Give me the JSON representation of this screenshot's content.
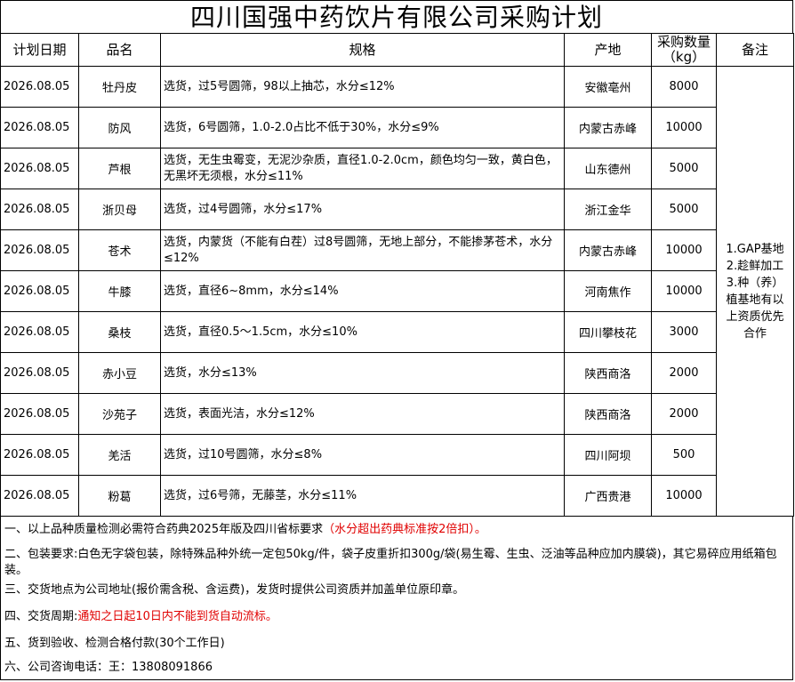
{
  "title": "四川国强中药饮片有限公司采购计划",
  "headers": {
    "date": "计划日期",
    "name": "品名",
    "spec": "规格",
    "origin": "产地",
    "qty_line1": "采购数量",
    "qty_line2": "（kg）",
    "remark": "备注"
  },
  "rows": [
    {
      "date": "2026.08.05",
      "name": "牡丹皮",
      "spec": "选货，过5号圆筛，98以上抽芯，水分≤12%",
      "origin": "安徽亳州",
      "qty": "8000"
    },
    {
      "date": "2026.08.05",
      "name": "防风",
      "spec": "选货，6号圆筛，1.0-2.0占比不低于30%，水分≤9%",
      "origin": "内蒙古赤峰",
      "qty": "10000"
    },
    {
      "date": "2026.08.05",
      "name": "芦根",
      "spec": "选货，无生虫霉变，无泥沙杂质，直径1.0-2.0cm，颜色均匀一致，黄白色，无黑坏无须根，水分≤11%",
      "origin": "山东德州",
      "qty": "5000"
    },
    {
      "date": "2026.08.05",
      "name": "浙贝母",
      "spec": "选货，过4号圆筛，水分≤17%",
      "origin": "浙江金华",
      "qty": "5000"
    },
    {
      "date": "2026.08.05",
      "name": "苍术",
      "spec": "选货，内蒙货（不能有白茬）过8号圆筛，无地上部分，不能掺茅苍术，水分≤12%",
      "origin": "内蒙古赤峰",
      "qty": "10000"
    },
    {
      "date": "2026.08.05",
      "name": "牛膝",
      "spec": "选货，直径6~8mm，水分≤14%",
      "origin": "河南焦作",
      "qty": "10000"
    },
    {
      "date": "2026.08.05",
      "name": "桑枝",
      "spec": "选货，直径0.5～1.5cm，水分≤10%",
      "origin": "四川攀枝花",
      "qty": "3000"
    },
    {
      "date": "2026.08.05",
      "name": "赤小豆",
      "spec": "选货，水分≤13%",
      "origin": "陕西商洛",
      "qty": "2000"
    },
    {
      "date": "2026.08.05",
      "name": "沙苑子",
      "spec": "选货，表面光洁，水分≤12%",
      "origin": "陕西商洛",
      "qty": "2000"
    },
    {
      "date": "2026.08.05",
      "name": "羌活",
      "spec": "选货，过10号圆筛，水分≤8%",
      "origin": "四川阿坝",
      "qty": "500"
    },
    {
      "date": "2026.08.05",
      "name": "粉葛",
      "spec": "选货，过6号筛，无藤茎，水分≤11%",
      "origin": "广西贵港",
      "qty": "10000"
    }
  ],
  "remark": {
    "line1": "1.GAP基地",
    "line2": "2.趁鲜加工",
    "line3": "3.种（养）",
    "line4": "植基地有以",
    "line5": "上资质优先",
    "line6": "合作"
  },
  "notes": {
    "n1_text": "一、以上品种质量检测必需符合药典2025年版及四川省标要求",
    "n1_red": "（水分超出药典标准按2倍扣）。",
    "n2_text": "二、包装要求:白色无字袋包装，除特殊品种外统一定包50kg/件，袋子皮重折扣300g/袋(易生霉、生虫、泛油等品种应加内膜袋)，其它易碎应用纸箱包装。",
    "n3_text": "三、交货地点为公司地址(报价需含税、含运费)，发货时提供公司资质并加盖单位原印章。",
    "n4_text": "四、交货周期:",
    "n4_red": "通知之日起10日内不能到货自动流标。",
    "n5_text": "五、货到验收、检测合格付款(30个工作日)",
    "n6_text": "六、公司咨询电话：王：13808091866"
  },
  "colors": {
    "note_red": "#e00000",
    "border": "#000000"
  }
}
